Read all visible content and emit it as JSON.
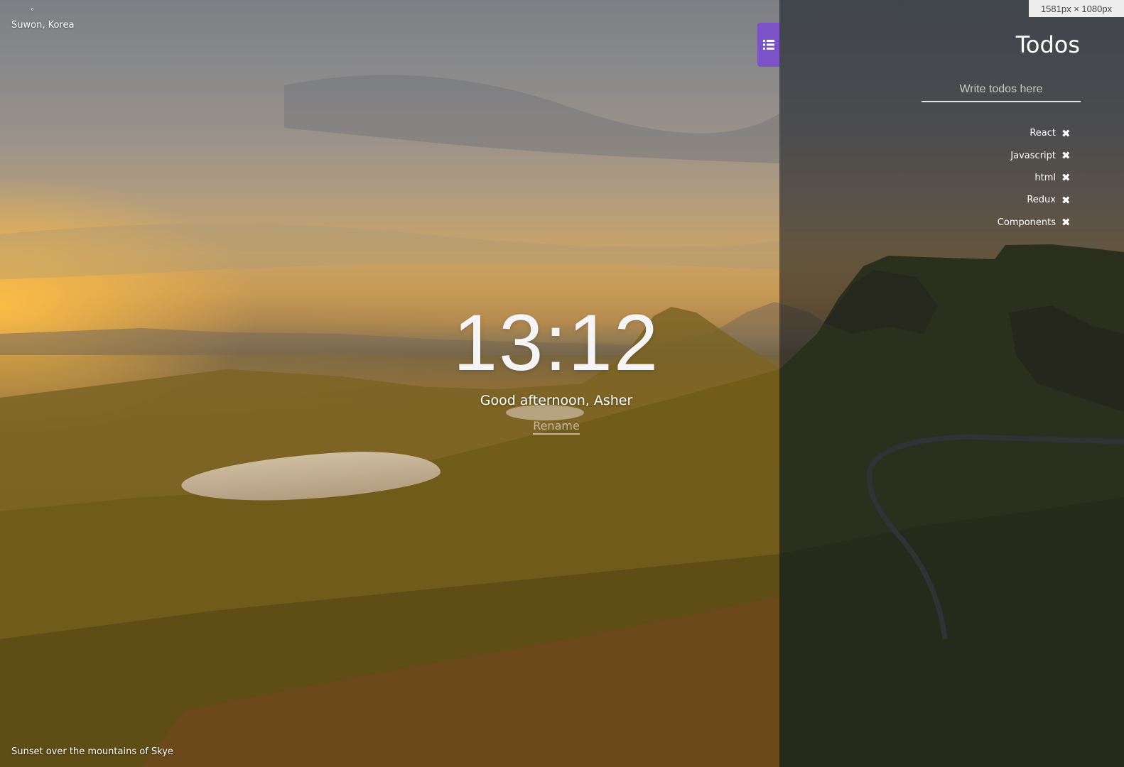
{
  "weather": {
    "icon_glyph": "°",
    "location": "Suwon, Korea"
  },
  "clock": {
    "time": "13:12"
  },
  "greeting": {
    "text": "Good afternoon, Asher",
    "rename_label": "Rename"
  },
  "background": {
    "caption": "Sunset over the mountains of Skye"
  },
  "todos": {
    "title": "Todos",
    "input_placeholder": "Write todos here",
    "delete_glyph": "✖",
    "items": [
      {
        "label": "React"
      },
      {
        "label": "Javascript"
      },
      {
        "label": "html"
      },
      {
        "label": "Redux"
      },
      {
        "label": "Components"
      }
    ],
    "toggle_icon": "list-icon",
    "accent_color": "#7b52c7"
  },
  "viewport_badge": "1581px × 1080px"
}
